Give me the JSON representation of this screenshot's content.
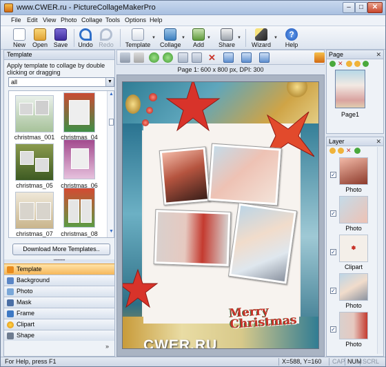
{
  "window": {
    "title": "www.CWER.ru - PictureCollageMakerPro"
  },
  "menu": [
    "File",
    "Edit",
    "View",
    "Photo",
    "Collage",
    "Tools",
    "Options",
    "Help"
  ],
  "toolbar": {
    "new": "New",
    "open": "Open",
    "save": "Save",
    "undo": "Undo",
    "redo": "Redo",
    "template": "Template",
    "collage": "Collage",
    "add": "Add",
    "share": "Share",
    "wizard": "Wizard",
    "help": "Help"
  },
  "left_panel": {
    "title": "Template",
    "hint": "Apply template to collage by double clicking or dragging",
    "filter_value": "all",
    "templates": [
      {
        "label": "christmas_001"
      },
      {
        "label": "christmas_04"
      },
      {
        "label": "christmas_05"
      },
      {
        "label": "christmas_06"
      },
      {
        "label": "christmas_07"
      },
      {
        "label": "christmas_08"
      }
    ],
    "download_button": "Download More Templates..",
    "categories": [
      "Template",
      "Background",
      "Photo",
      "Mask",
      "Frame",
      "Clipart",
      "Shape"
    ],
    "active_category": "Template"
  },
  "canvas": {
    "page_info": "Page 1: 600 x 800 px, DPI: 300",
    "greeting_line1": "Merry",
    "greeting_line2": "Christmas",
    "watermark": "CWER.RU"
  },
  "page_panel": {
    "title": "Page",
    "page_label": "Page1"
  },
  "layer_panel": {
    "title": "Layer",
    "layers": [
      {
        "label": "Photo",
        "checked": true
      },
      {
        "label": "Photo",
        "checked": true
      },
      {
        "label": "Clipart",
        "checked": true
      },
      {
        "label": "Photo",
        "checked": true
      },
      {
        "label": "Photo",
        "checked": true
      }
    ]
  },
  "status": {
    "help": "For Help, press F1",
    "coords": "X=588, Y=160",
    "cap": "CAP",
    "num": "NUM",
    "scrl": "SCRL"
  }
}
